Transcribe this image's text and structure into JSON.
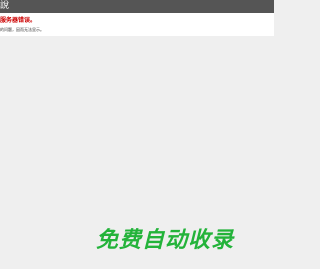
{
  "window": {
    "title": "說"
  },
  "error": {
    "heading": "服务器错误。",
    "detail": "的问题，因而无法显示。"
  },
  "watermark": {
    "text": "免费自动收录"
  },
  "colors": {
    "title_bar": "#555555",
    "background": "#efefef",
    "error_heading": "#cc0000",
    "watermark": "#23b33a"
  }
}
